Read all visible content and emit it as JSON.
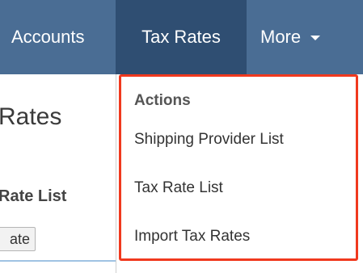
{
  "nav": {
    "accounts_label": "Accounts",
    "tax_rates_label": "Tax Rates",
    "more_label": "More"
  },
  "page": {
    "title": "Rates",
    "subheading": "Rate List",
    "button_label": "ate"
  },
  "dropdown": {
    "header": "Actions",
    "items": [
      {
        "label": "Shipping Provider List"
      },
      {
        "label": "Tax Rate List"
      },
      {
        "label": "Import Tax Rates"
      }
    ]
  },
  "colors": {
    "nav_background": "#4a6d94",
    "nav_active_background": "#2f4e72",
    "highlight_border": "#f0391e"
  },
  "icons": {
    "more_caret": "caret-down-icon"
  }
}
